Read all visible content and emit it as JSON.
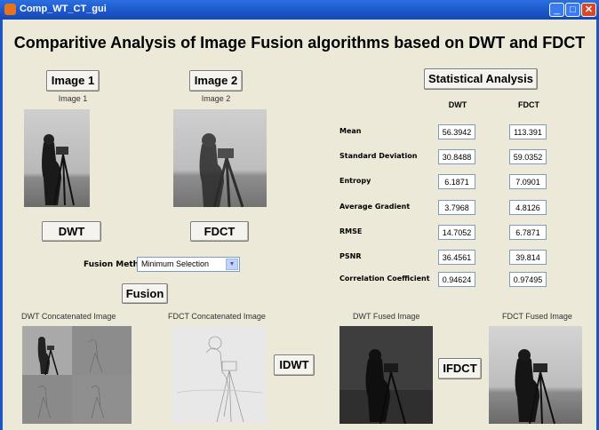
{
  "window": {
    "title": "Comp_WT_CT_gui"
  },
  "main_title": "Comparitive Analysis of Image Fusion algorithms based on DWT and FDCT",
  "buttons": {
    "image1": "Image 1",
    "image2": "Image 2",
    "statistical_analysis": "Statistical Analysis",
    "dwt": "DWT",
    "fdct": "FDCT",
    "fusion": "Fusion",
    "idwt": "IDWT",
    "ifdct": "IFDCT"
  },
  "labels": {
    "image1": "Image 1",
    "image2": "Image 2",
    "fusion_method": "Fusion Method",
    "dwt_concat": "DWT Concatenated Image",
    "fdct_concat": "FDCT Concatenated Image",
    "dwt_fused": "DWT Fused Image",
    "fdct_fused": "FDCT Fused Image"
  },
  "fusion_method": {
    "selected": "Minimum Selection"
  },
  "stats": {
    "columns": [
      "DWT",
      "FDCT"
    ],
    "rows": [
      {
        "label": "Mean",
        "dwt": "56.3942",
        "fdct": "113.391"
      },
      {
        "label": "Standard Deviation",
        "dwt": "30.8488",
        "fdct": "59.0352"
      },
      {
        "label": "Entropy",
        "dwt": "6.1871",
        "fdct": "7.0901"
      },
      {
        "label": "Average Gradient",
        "dwt": "3.7968",
        "fdct": "4.8126"
      },
      {
        "label": "RMSE",
        "dwt": "14.7052",
        "fdct": "6.7871"
      },
      {
        "label": "PSNR",
        "dwt": "36.4561",
        "fdct": "39.814"
      },
      {
        "label": "Correlation Coefficient",
        "dwt": "0.94624",
        "fdct": "0.97495"
      }
    ]
  },
  "icons": {
    "app": "matlab-figure-icon",
    "minimize": "minimize-icon",
    "maximize": "maximize-icon",
    "close": "close-icon"
  },
  "colors": {
    "titlebar": "#1B56C8",
    "background": "#ECE9D8",
    "close": "#D9472B"
  }
}
